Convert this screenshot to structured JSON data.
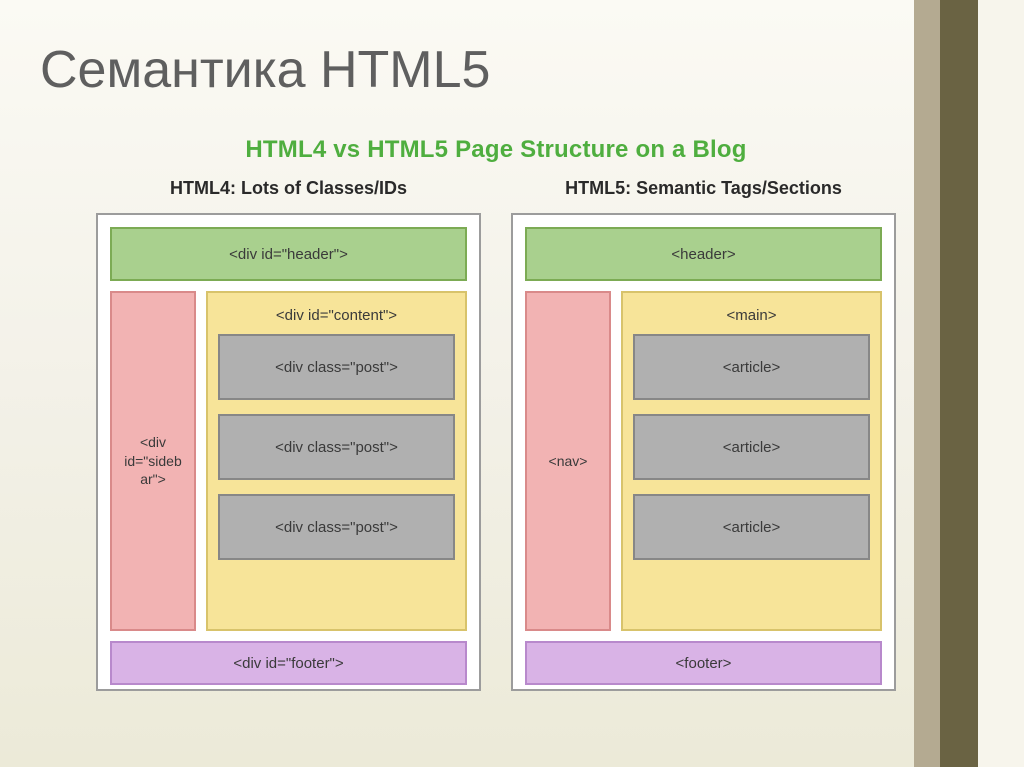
{
  "slide": {
    "title": "Семантика HTML5"
  },
  "diagram": {
    "title": "HTML4 vs HTML5 Page Structure on a Blog",
    "html4": {
      "title": "HTML4: Lots of Classes/IDs",
      "header": "<div id=\"header\">",
      "sidebar": "<div id=\"sideb ar\">",
      "main": "<div id=\"content\">",
      "posts": [
        "<div class=\"post\">",
        "<div class=\"post\">",
        "<div class=\"post\">"
      ],
      "footer": "<div id=\"footer\">"
    },
    "html5": {
      "title": "HTML5: Semantic Tags/Sections",
      "header": "<header>",
      "sidebar": "<nav>",
      "main": "<main>",
      "posts": [
        "<article>",
        "<article>",
        "<article>"
      ],
      "footer": "<footer>"
    }
  }
}
